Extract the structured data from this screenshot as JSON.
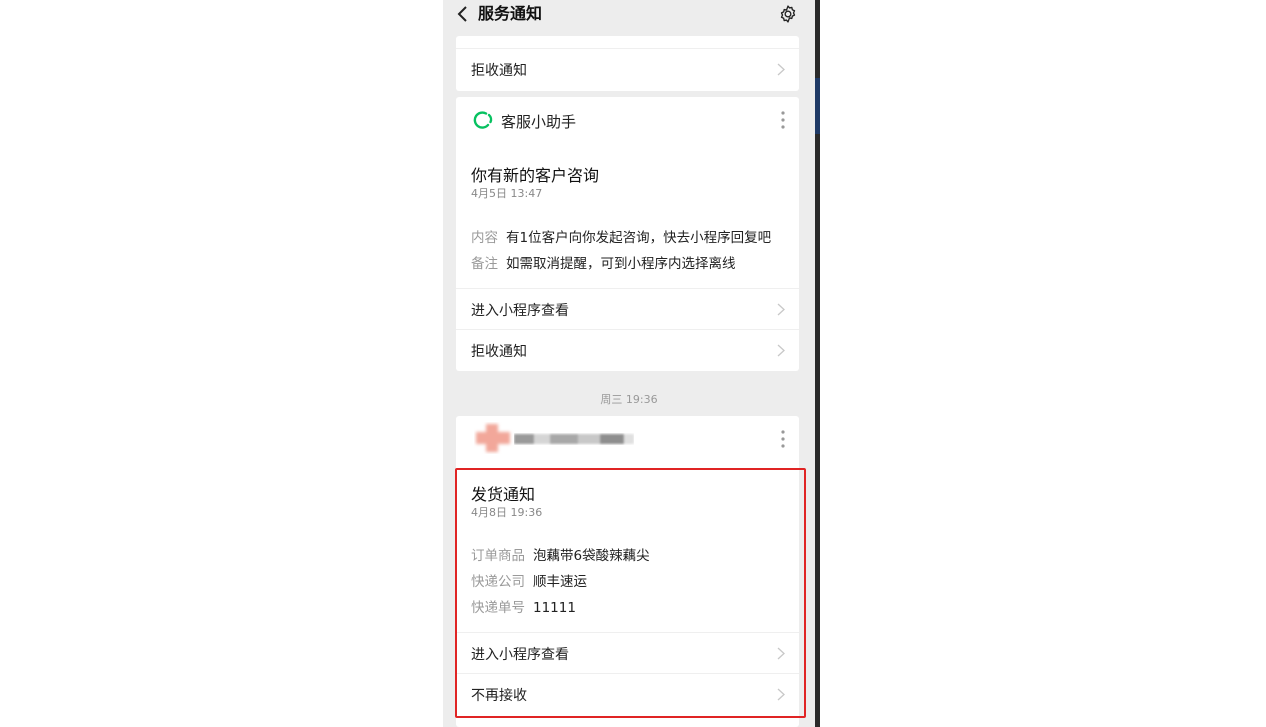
{
  "header": {
    "title": "服务通知"
  },
  "top_card": {
    "reject_label": "拒收通知"
  },
  "kefu_card": {
    "service_name": "客服小助手",
    "title": "你有新的客户咨询",
    "date": "4月5日 13:47",
    "fields": [
      {
        "key": "内容",
        "value": "有1位客户向你发起咨询，快去小程序回复吧"
      },
      {
        "key": "备注",
        "value": "如需取消提醒，可到小程序内选择离线"
      }
    ],
    "actions": [
      {
        "label": "进入小程序查看"
      },
      {
        "label": "拒收通知"
      }
    ]
  },
  "timestamp": "周三 19:36",
  "shipping_card": {
    "title": "发货通知",
    "date": "4月8日 19:36",
    "fields": [
      {
        "key": "订单商品",
        "value": "泡藕带6袋酸辣藕尖"
      },
      {
        "key": "快递公司",
        "value": "顺丰速运"
      },
      {
        "key": "快递单号",
        "value": "11111"
      }
    ],
    "actions": [
      {
        "label": "进入小程序查看"
      },
      {
        "label": "不再接收"
      }
    ]
  },
  "colors": {
    "highlight": "#e02424",
    "service_green": "#07c160",
    "background": "#ededed"
  }
}
